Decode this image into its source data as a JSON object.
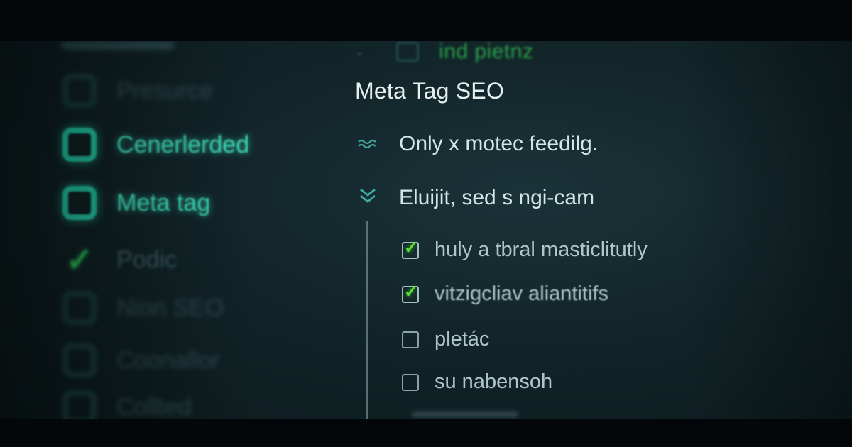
{
  "left_list": {
    "items": [
      {
        "label": "Presurce",
        "state": "box",
        "style": "faint"
      },
      {
        "label": "Cenerlerded",
        "state": "box",
        "style": "bright"
      },
      {
        "label": "Meta tag",
        "state": "box",
        "style": "bright"
      },
      {
        "label": "Podic",
        "state": "check",
        "style": "mid"
      },
      {
        "label": "Nion SEO",
        "state": "box",
        "style": "faint"
      },
      {
        "label": "Coonallor",
        "state": "box",
        "style": "faint"
      },
      {
        "label": "Collted",
        "state": "box",
        "style": "faint"
      }
    ]
  },
  "panel": {
    "top_fragment": "ind pietnz",
    "title": "Meta Tag SEO",
    "rows": [
      {
        "icon": "double-wave-icon",
        "glyph": "≈",
        "text": "Only x motec feedilg."
      },
      {
        "icon": "double-chevron-icon",
        "glyph": "⌄",
        "text": "Eluijit, sed s ngi-cam"
      }
    ],
    "sub_items": [
      {
        "text": "huly a tbral masticlitutly",
        "checked": true
      },
      {
        "text": "vitzigcliav aliantitifs",
        "checked": true
      },
      {
        "text": "pletác",
        "checked": false
      },
      {
        "text": "su nabensoh",
        "checked": false
      }
    ]
  },
  "colors": {
    "accent_teal": "#22c8a4",
    "check_green": "#56e12c",
    "background": "#0d1e22"
  }
}
